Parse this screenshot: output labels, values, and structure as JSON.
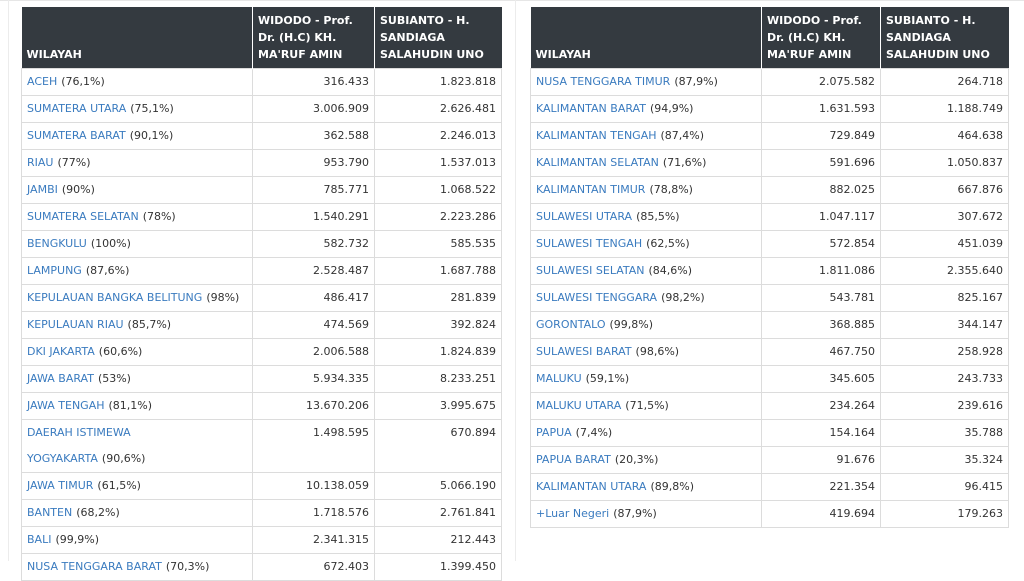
{
  "headers": {
    "wilayah": "WILAYAH",
    "candidate_1": "WIDODO - Prof. Dr. (H.C) KH. MA'RUF AMIN",
    "candidate_2": "SUBIANTO - H. SANDIAGA SALAHUDIN UNO"
  },
  "left_table": [
    {
      "name": "ACEH",
      "pct": "(76,1%)",
      "c1": "316.433",
      "c2": "1.823.818"
    },
    {
      "name": "SUMATERA UTARA",
      "pct": "(75,1%)",
      "c1": "3.006.909",
      "c2": "2.626.481"
    },
    {
      "name": "SUMATERA BARAT",
      "pct": "(90,1%)",
      "c1": "362.588",
      "c2": "2.246.013"
    },
    {
      "name": "RIAU",
      "pct": "(77%)",
      "c1": "953.790",
      "c2": "1.537.013"
    },
    {
      "name": "JAMBI",
      "pct": "(90%)",
      "c1": "785.771",
      "c2": "1.068.522"
    },
    {
      "name": "SUMATERA SELATAN",
      "pct": "(78%)",
      "c1": "1.540.291",
      "c2": "2.223.286"
    },
    {
      "name": "BENGKULU",
      "pct": "(100%)",
      "c1": "582.732",
      "c2": "585.535"
    },
    {
      "name": "LAMPUNG",
      "pct": "(87,6%)",
      "c1": "2.528.487",
      "c2": "1.687.788"
    },
    {
      "name": "KEPULAUAN BANGKA BELITUNG",
      "pct": "(98%)",
      "c1": "486.417",
      "c2": "281.839"
    },
    {
      "name": "KEPULAUAN RIAU",
      "pct": "(85,7%)",
      "c1": "474.569",
      "c2": "392.824"
    },
    {
      "name": "DKI JAKARTA",
      "pct": "(60,6%)",
      "c1": "2.006.588",
      "c2": "1.824.839"
    },
    {
      "name": "JAWA BARAT",
      "pct": "(53%)",
      "c1": "5.934.335",
      "c2": "8.233.251"
    },
    {
      "name": "JAWA TENGAH",
      "pct": "(81,1%)",
      "c1": "13.670.206",
      "c2": "3.995.675"
    },
    {
      "name": "DAERAH ISTIMEWA YOGYAKARTA",
      "pct": "(90,6%)",
      "c1": "1.498.595",
      "c2": "670.894"
    },
    {
      "name": "JAWA TIMUR",
      "pct": "(61,5%)",
      "c1": "10.138.059",
      "c2": "5.066.190"
    },
    {
      "name": "BANTEN",
      "pct": "(68,2%)",
      "c1": "1.718.576",
      "c2": "2.761.841"
    },
    {
      "name": "BALI",
      "pct": "(99,9%)",
      "c1": "2.341.315",
      "c2": "212.443"
    },
    {
      "name": "NUSA TENGGARA BARAT",
      "pct": "(70,3%)",
      "c1": "672.403",
      "c2": "1.399.450"
    }
  ],
  "right_table": [
    {
      "name": "NUSA TENGGARA TIMUR",
      "pct": "(87,9%)",
      "c1": "2.075.582",
      "c2": "264.718"
    },
    {
      "name": "KALIMANTAN BARAT",
      "pct": "(94,9%)",
      "c1": "1.631.593",
      "c2": "1.188.749"
    },
    {
      "name": "KALIMANTAN TENGAH",
      "pct": "(87,4%)",
      "c1": "729.849",
      "c2": "464.638"
    },
    {
      "name": "KALIMANTAN SELATAN",
      "pct": "(71,6%)",
      "c1": "591.696",
      "c2": "1.050.837"
    },
    {
      "name": "KALIMANTAN TIMUR",
      "pct": "(78,8%)",
      "c1": "882.025",
      "c2": "667.876"
    },
    {
      "name": "SULAWESI UTARA",
      "pct": "(85,5%)",
      "c1": "1.047.117",
      "c2": "307.672"
    },
    {
      "name": "SULAWESI TENGAH",
      "pct": "(62,5%)",
      "c1": "572.854",
      "c2": "451.039"
    },
    {
      "name": "SULAWESI SELATAN",
      "pct": "(84,6%)",
      "c1": "1.811.086",
      "c2": "2.355.640"
    },
    {
      "name": "SULAWESI TENGGARA",
      "pct": "(98,2%)",
      "c1": "543.781",
      "c2": "825.167"
    },
    {
      "name": "GORONTALO",
      "pct": "(99,8%)",
      "c1": "368.885",
      "c2": "344.147"
    },
    {
      "name": "SULAWESI BARAT",
      "pct": "(98,6%)",
      "c1": "467.750",
      "c2": "258.928"
    },
    {
      "name": "MALUKU",
      "pct": "(59,1%)",
      "c1": "345.605",
      "c2": "243.733"
    },
    {
      "name": "MALUKU UTARA",
      "pct": "(71,5%)",
      "c1": "234.264",
      "c2": "239.616"
    },
    {
      "name": "PAPUA",
      "pct": "(7,4%)",
      "c1": "154.164",
      "c2": "35.788"
    },
    {
      "name": "PAPUA BARAT",
      "pct": "(20,3%)",
      "c1": "91.676",
      "c2": "35.324"
    },
    {
      "name": "KALIMANTAN UTARA",
      "pct": "(89,8%)",
      "c1": "221.354",
      "c2": "96.415"
    },
    {
      "name": "+Luar Negeri",
      "pct": "(87,9%)",
      "c1": "419.694",
      "c2": "179.263"
    }
  ]
}
